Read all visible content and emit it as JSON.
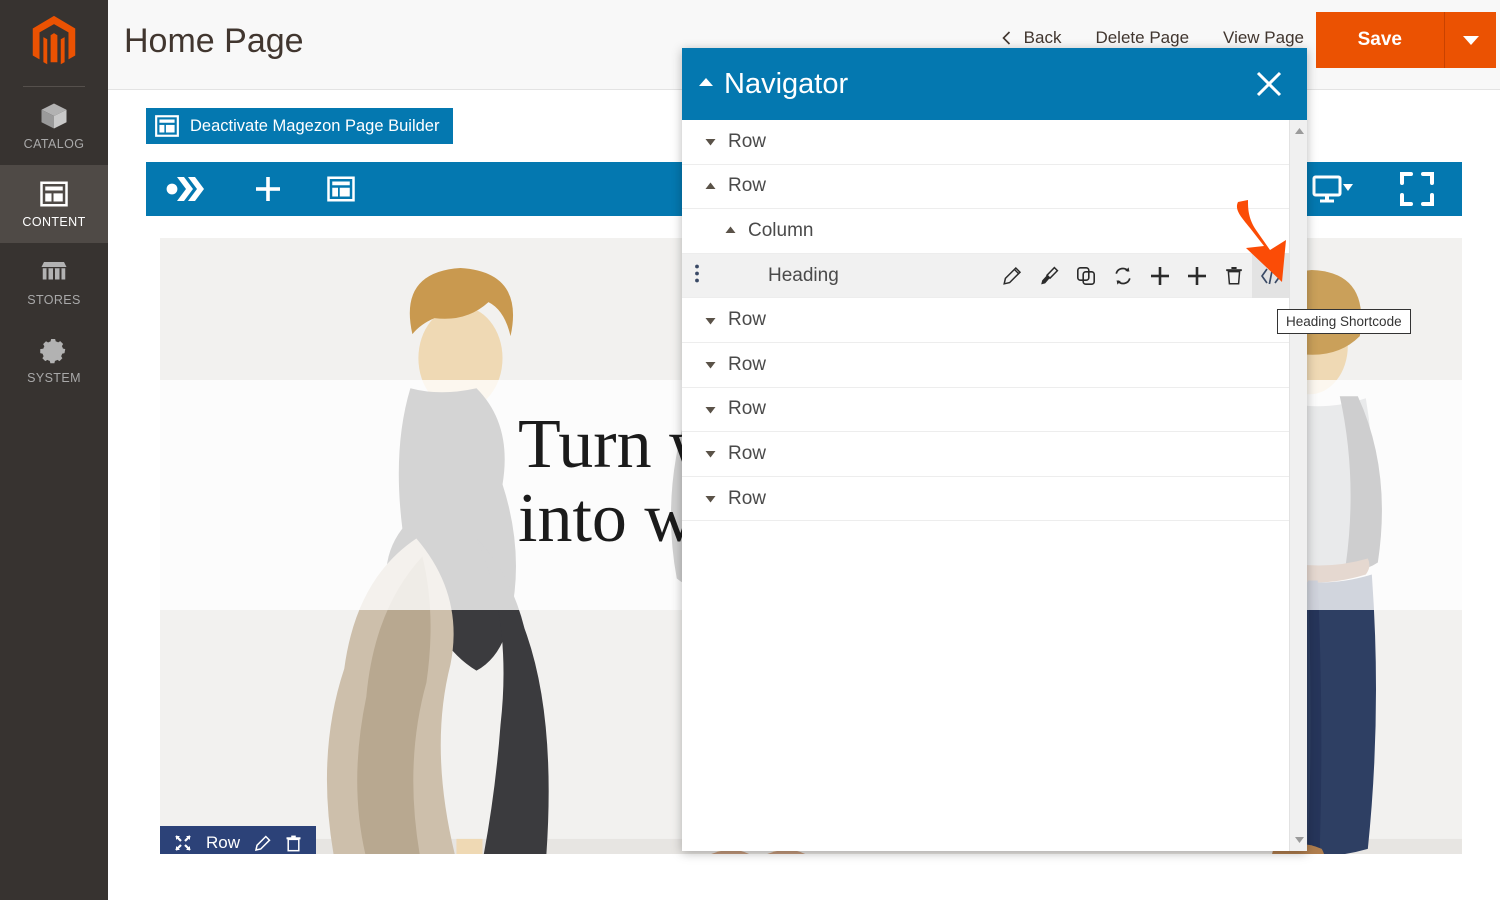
{
  "colors": {
    "magento_orange": "#eb5202",
    "panel_blue": "#0478b0",
    "sidebar_dark": "#373330",
    "row_badge_blue": "#2c4278",
    "annotation_orange": "#fb4c06"
  },
  "sidebar": {
    "logo_name": "magento-logo",
    "items": [
      {
        "label": "Catalog",
        "icon": "box-icon",
        "active": false
      },
      {
        "label": "Content",
        "icon": "layout-icon",
        "active": true
      },
      {
        "label": "Stores",
        "icon": "storefront-icon",
        "active": false
      },
      {
        "label": "System",
        "icon": "gear-icon",
        "active": false
      }
    ]
  },
  "header": {
    "title": "Home Page",
    "actions": [
      {
        "label": "Back",
        "icon": "chevron-left-icon"
      },
      {
        "label": "Delete Page",
        "icon": ""
      },
      {
        "label": "View Page",
        "icon": ""
      }
    ],
    "save_label": "Save",
    "save_caret_icon": "caret-down-icon"
  },
  "page_builder": {
    "deactivate_label": "Deactivate Magezon Page Builder",
    "deactivate_icon": "layout-icon",
    "toolbar_left_icons": [
      {
        "name": "magezon-logo-icon"
      },
      {
        "name": "add-element-icon"
      },
      {
        "name": "templates-icon"
      }
    ],
    "toolbar_right_icons": [
      {
        "name": "device-preview-icon"
      },
      {
        "name": "fullscreen-icon"
      }
    ]
  },
  "canvas": {
    "hero_line1": "Turn w",
    "hero_line2": "into w",
    "row_badge": {
      "label": "Row",
      "icons": [
        {
          "name": "move-icon"
        },
        {
          "name": "edit-pencil-icon"
        },
        {
          "name": "trash-icon"
        }
      ]
    }
  },
  "navigator": {
    "title": "Navigator",
    "collapse_icon": "caret-up-icon",
    "close_icon": "close-icon",
    "items": [
      {
        "label": "Row",
        "depth": 0,
        "caret": "down",
        "selected": false,
        "tools": false
      },
      {
        "label": "Row",
        "depth": 0,
        "caret": "up",
        "selected": false,
        "tools": false
      },
      {
        "label": "Column",
        "depth": 1,
        "caret": "up",
        "selected": false,
        "tools": false
      },
      {
        "label": "Heading",
        "depth": 2,
        "caret": "none",
        "selected": true,
        "tools": true
      },
      {
        "label": "Row",
        "depth": 0,
        "caret": "down",
        "selected": false,
        "tools": false
      },
      {
        "label": "Row",
        "depth": 0,
        "caret": "down",
        "selected": false,
        "tools": false
      },
      {
        "label": "Row",
        "depth": 0,
        "caret": "down",
        "selected": false,
        "tools": false
      },
      {
        "label": "Row",
        "depth": 0,
        "caret": "down",
        "selected": false,
        "tools": false
      },
      {
        "label": "Row",
        "depth": 0,
        "caret": "down",
        "selected": false,
        "tools": false
      }
    ],
    "row_tools": [
      {
        "name": "edit-pencil-icon",
        "title": "Edit"
      },
      {
        "name": "brush-style-icon",
        "title": "Style"
      },
      {
        "name": "duplicate-icon",
        "title": "Duplicate"
      },
      {
        "name": "replace-icon",
        "title": "Replace"
      },
      {
        "name": "add-before-icon",
        "title": "Add"
      },
      {
        "name": "add-after-icon",
        "title": "Add"
      },
      {
        "name": "trash-icon",
        "title": "Delete"
      },
      {
        "name": "shortcode-icon",
        "title": "Shortcode"
      }
    ],
    "scrollbar": {
      "up_icon": "scroll-up-arrow-icon",
      "down_icon": "scroll-down-arrow-icon"
    }
  },
  "tooltip": {
    "text": "Heading Shortcode"
  }
}
